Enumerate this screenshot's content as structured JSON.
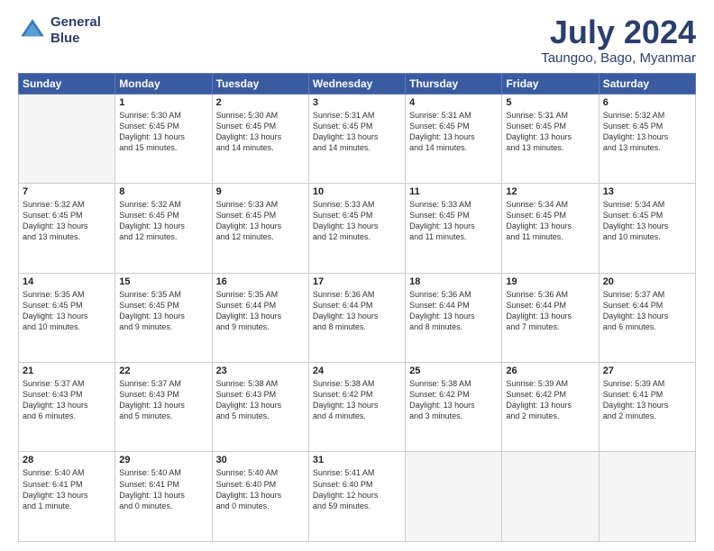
{
  "header": {
    "logo_line1": "General",
    "logo_line2": "Blue",
    "main_title": "July 2024",
    "subtitle": "Taungoo, Bago, Myanmar"
  },
  "weekdays": [
    "Sunday",
    "Monday",
    "Tuesday",
    "Wednesday",
    "Thursday",
    "Friday",
    "Saturday"
  ],
  "weeks": [
    [
      {
        "day": "",
        "info": ""
      },
      {
        "day": "1",
        "info": "Sunrise: 5:30 AM\nSunset: 6:45 PM\nDaylight: 13 hours\nand 15 minutes."
      },
      {
        "day": "2",
        "info": "Sunrise: 5:30 AM\nSunset: 6:45 PM\nDaylight: 13 hours\nand 14 minutes."
      },
      {
        "day": "3",
        "info": "Sunrise: 5:31 AM\nSunset: 6:45 PM\nDaylight: 13 hours\nand 14 minutes."
      },
      {
        "day": "4",
        "info": "Sunrise: 5:31 AM\nSunset: 6:45 PM\nDaylight: 13 hours\nand 14 minutes."
      },
      {
        "day": "5",
        "info": "Sunrise: 5:31 AM\nSunset: 6:45 PM\nDaylight: 13 hours\nand 13 minutes."
      },
      {
        "day": "6",
        "info": "Sunrise: 5:32 AM\nSunset: 6:45 PM\nDaylight: 13 hours\nand 13 minutes."
      }
    ],
    [
      {
        "day": "7",
        "info": "Sunrise: 5:32 AM\nSunset: 6:45 PM\nDaylight: 13 hours\nand 13 minutes."
      },
      {
        "day": "8",
        "info": "Sunrise: 5:32 AM\nSunset: 6:45 PM\nDaylight: 13 hours\nand 12 minutes."
      },
      {
        "day": "9",
        "info": "Sunrise: 5:33 AM\nSunset: 6:45 PM\nDaylight: 13 hours\nand 12 minutes."
      },
      {
        "day": "10",
        "info": "Sunrise: 5:33 AM\nSunset: 6:45 PM\nDaylight: 13 hours\nand 12 minutes."
      },
      {
        "day": "11",
        "info": "Sunrise: 5:33 AM\nSunset: 6:45 PM\nDaylight: 13 hours\nand 11 minutes."
      },
      {
        "day": "12",
        "info": "Sunrise: 5:34 AM\nSunset: 6:45 PM\nDaylight: 13 hours\nand 11 minutes."
      },
      {
        "day": "13",
        "info": "Sunrise: 5:34 AM\nSunset: 6:45 PM\nDaylight: 13 hours\nand 10 minutes."
      }
    ],
    [
      {
        "day": "14",
        "info": "Sunrise: 5:35 AM\nSunset: 6:45 PM\nDaylight: 13 hours\nand 10 minutes."
      },
      {
        "day": "15",
        "info": "Sunrise: 5:35 AM\nSunset: 6:45 PM\nDaylight: 13 hours\nand 9 minutes."
      },
      {
        "day": "16",
        "info": "Sunrise: 5:35 AM\nSunset: 6:44 PM\nDaylight: 13 hours\nand 9 minutes."
      },
      {
        "day": "17",
        "info": "Sunrise: 5:36 AM\nSunset: 6:44 PM\nDaylight: 13 hours\nand 8 minutes."
      },
      {
        "day": "18",
        "info": "Sunrise: 5:36 AM\nSunset: 6:44 PM\nDaylight: 13 hours\nand 8 minutes."
      },
      {
        "day": "19",
        "info": "Sunrise: 5:36 AM\nSunset: 6:44 PM\nDaylight: 13 hours\nand 7 minutes."
      },
      {
        "day": "20",
        "info": "Sunrise: 5:37 AM\nSunset: 6:44 PM\nDaylight: 13 hours\nand 6 minutes."
      }
    ],
    [
      {
        "day": "21",
        "info": "Sunrise: 5:37 AM\nSunset: 6:43 PM\nDaylight: 13 hours\nand 6 minutes."
      },
      {
        "day": "22",
        "info": "Sunrise: 5:37 AM\nSunset: 6:43 PM\nDaylight: 13 hours\nand 5 minutes."
      },
      {
        "day": "23",
        "info": "Sunrise: 5:38 AM\nSunset: 6:43 PM\nDaylight: 13 hours\nand 5 minutes."
      },
      {
        "day": "24",
        "info": "Sunrise: 5:38 AM\nSunset: 6:42 PM\nDaylight: 13 hours\nand 4 minutes."
      },
      {
        "day": "25",
        "info": "Sunrise: 5:38 AM\nSunset: 6:42 PM\nDaylight: 13 hours\nand 3 minutes."
      },
      {
        "day": "26",
        "info": "Sunrise: 5:39 AM\nSunset: 6:42 PM\nDaylight: 13 hours\nand 2 minutes."
      },
      {
        "day": "27",
        "info": "Sunrise: 5:39 AM\nSunset: 6:41 PM\nDaylight: 13 hours\nand 2 minutes."
      }
    ],
    [
      {
        "day": "28",
        "info": "Sunrise: 5:40 AM\nSunset: 6:41 PM\nDaylight: 13 hours\nand 1 minute."
      },
      {
        "day": "29",
        "info": "Sunrise: 5:40 AM\nSunset: 6:41 PM\nDaylight: 13 hours\nand 0 minutes."
      },
      {
        "day": "30",
        "info": "Sunrise: 5:40 AM\nSunset: 6:40 PM\nDaylight: 13 hours\nand 0 minutes."
      },
      {
        "day": "31",
        "info": "Sunrise: 5:41 AM\nSunset: 6:40 PM\nDaylight: 12 hours\nand 59 minutes."
      },
      {
        "day": "",
        "info": ""
      },
      {
        "day": "",
        "info": ""
      },
      {
        "day": "",
        "info": ""
      }
    ]
  ]
}
